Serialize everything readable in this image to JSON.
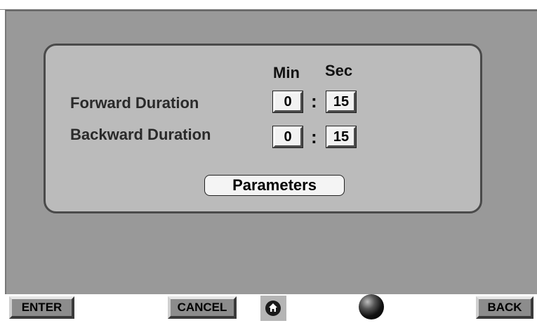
{
  "panel": {
    "min_header": "Min",
    "sec_header": "Sec",
    "forward": {
      "label": "Forward Duration",
      "min": "0",
      "sec": "15"
    },
    "backward": {
      "label": "Backward Duration",
      "min": "0",
      "sec": "15"
    },
    "separator": ":",
    "parameters_label": "Parameters"
  },
  "footer": {
    "enter_label": "ENTER",
    "cancel_label": "CANCEL",
    "back_label": "BACK",
    "home_icon": "home-icon",
    "status_icon": "status-ball-icon"
  }
}
